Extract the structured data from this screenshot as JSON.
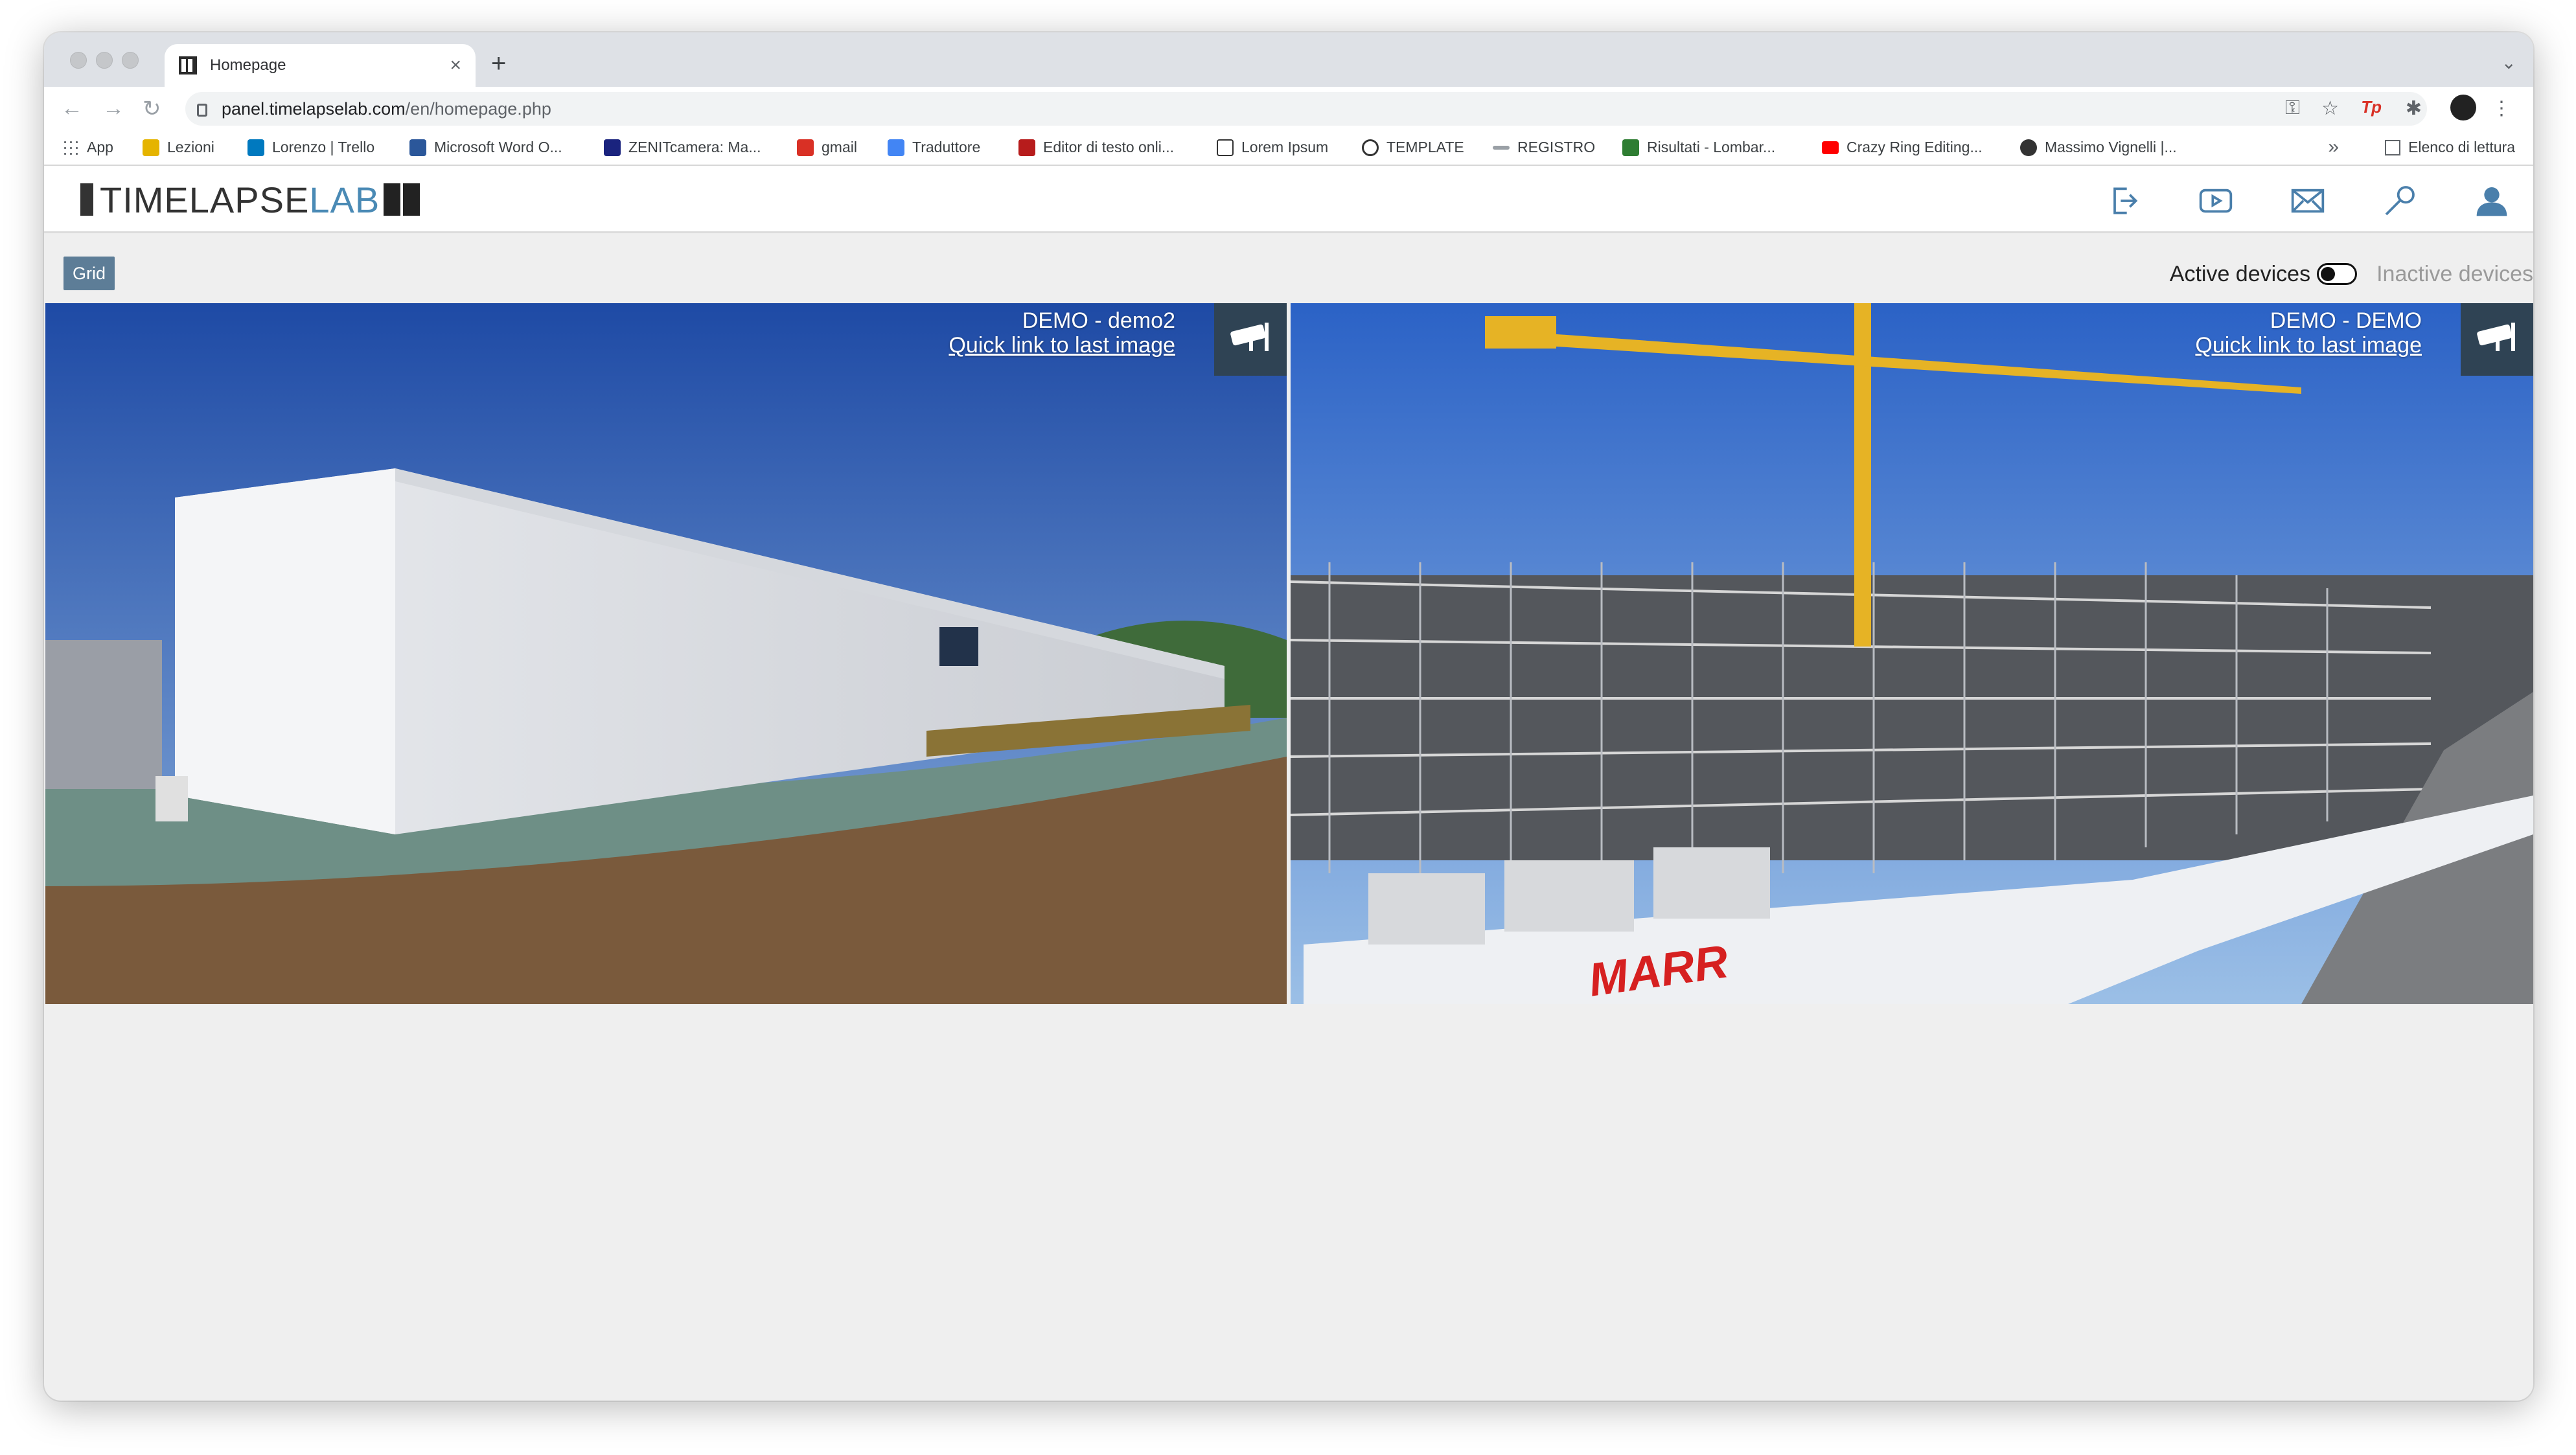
{
  "browser": {
    "tab_title": "Homepage",
    "url_host": "panel.timelapselab.com",
    "url_path": "/en/homepage.php",
    "bookmarks": [
      {
        "label": "App",
        "icon": "apps-grid-icon",
        "color": "#5f6368"
      },
      {
        "label": "Lezioni",
        "icon": "classroom-icon",
        "color": "#e5b400"
      },
      {
        "label": "Lorenzo | Trello",
        "icon": "trello-icon",
        "color": "#0079bf"
      },
      {
        "label": "Microsoft Word O...",
        "icon": "word-icon",
        "color": "#2b579a"
      },
      {
        "label": "ZENITcamera: Ma...",
        "icon": "zenit-icon",
        "color": "#1a237e"
      },
      {
        "label": "gmail",
        "icon": "gmail-icon",
        "color": "#d93025"
      },
      {
        "label": "Traduttore",
        "icon": "translate-icon",
        "color": "#4285f4"
      },
      {
        "label": "Editor di testo onli...",
        "icon": "editor-icon",
        "color": "#b71c1c"
      },
      {
        "label": "Lorem Ipsum",
        "icon": "lorem-icon",
        "color": "#333333"
      },
      {
        "label": "TEMPLATE",
        "icon": "template-icon",
        "color": "#333333"
      },
      {
        "label": "REGISTRO",
        "icon": "registro-icon",
        "color": "#5f6368"
      },
      {
        "label": "Risultati - Lombar...",
        "icon": "risultati-icon",
        "color": "#2e7d32"
      },
      {
        "label": "Crazy Ring Editing...",
        "icon": "youtube-icon",
        "color": "#ff0000"
      },
      {
        "label": "Massimo Vignelli |...",
        "icon": "vignelli-icon",
        "color": "#333333"
      }
    ],
    "more": "»",
    "reading_list": "Elenco di lettura"
  },
  "site": {
    "logo_part1": "TIMELAPSE",
    "logo_part2": "LAB",
    "header_icons": [
      "logout-icon",
      "play-icon",
      "mail-icon",
      "wrench-icon",
      "user-icon"
    ],
    "accent": "#4a7fab"
  },
  "controls": {
    "grid_label": "Grid",
    "active_label": "Active devices",
    "inactive_label": "Inactive devices"
  },
  "cameras": [
    {
      "title": "DEMO - demo2",
      "link": "Quick link to last image"
    },
    {
      "title": "DEMO - DEMO",
      "link": "Quick link to last image"
    }
  ],
  "photo_text": {
    "sign": "MARR"
  }
}
